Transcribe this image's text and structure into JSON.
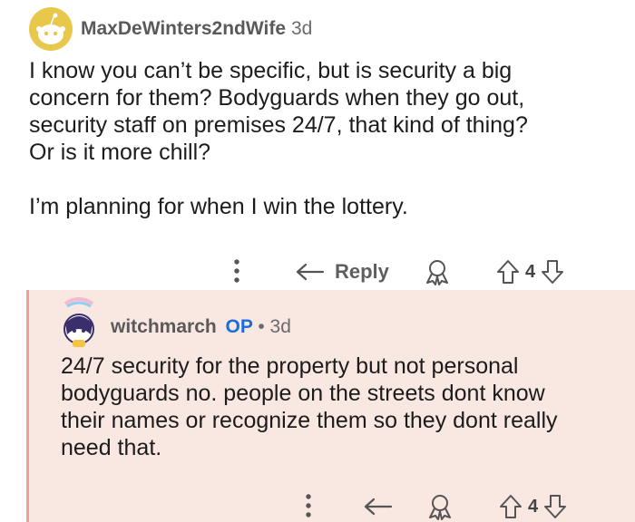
{
  "comment": {
    "username": "MaxDeWinters2ndWife",
    "age": "3d",
    "text": "I know you can’t be specific, but is security a big\nconcern for them? Bodyguards when they go out,\nsecurity staff on premises 24/7, that kind of thing?\nOr is it more chill?\n\nI’m planning for when I win the lottery.",
    "reply_label": "Reply",
    "vote_count": "4"
  },
  "reply": {
    "username": "witchmarch",
    "op_tag": "OP",
    "age": "• 3d",
    "text": "24/7 security for the property but not personal\nbodyguards no. people on the streets dont know\ntheir names or recognize them so they dont really\nneed that.",
    "vote_count": "4"
  },
  "colors": {
    "op_blue": "#1a6ed8",
    "reply_background": "#f9e7e1",
    "thread_line": "#f0a090",
    "avatar_yellow": "#e8c84a"
  },
  "icons": [
    "snoo-avatar",
    "more-vertical-icon",
    "reply-arrow-icon",
    "award-icon",
    "upvote-icon",
    "downvote-icon",
    "user-avatar"
  ]
}
